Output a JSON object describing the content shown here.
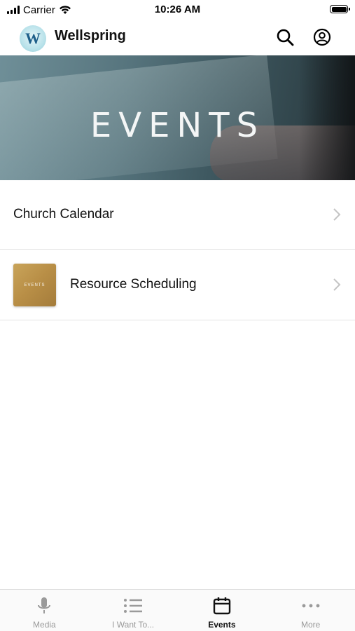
{
  "status_bar": {
    "carrier": "Carrier",
    "time": "10:26 AM"
  },
  "header": {
    "app_name": "Wellspring",
    "logo_letter": "W"
  },
  "hero": {
    "title": "EVENTS"
  },
  "list": {
    "items": [
      {
        "label": "Church Calendar",
        "icon": "chevron-right-icon"
      },
      {
        "label": "Resource Scheduling",
        "thumbnail_text": "EVENTS",
        "icon": "chevron-right-icon"
      }
    ]
  },
  "tabs": [
    {
      "label": "Media",
      "icon": "microphone-icon",
      "active": false
    },
    {
      "label": "I Want To...",
      "icon": "list-icon",
      "active": false
    },
    {
      "label": "Events",
      "icon": "calendar-icon",
      "active": true
    },
    {
      "label": "More",
      "icon": "more-dots-icon",
      "active": false
    }
  ],
  "colors": {
    "active_tab": "#111111",
    "inactive_tab": "#9a9a9a",
    "divider": "#e3e3e3"
  }
}
